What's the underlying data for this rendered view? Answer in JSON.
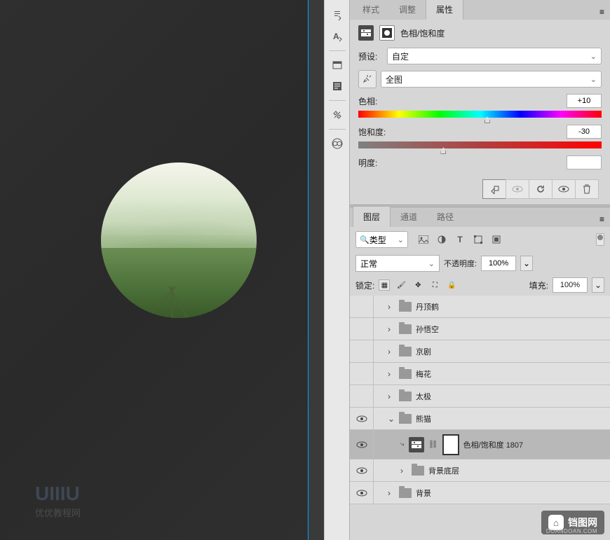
{
  "tabs": {
    "styles": "样式",
    "adjustments": "调整",
    "properties": "属性"
  },
  "properties": {
    "title": "色相/饱和度",
    "preset_label": "预设:",
    "preset_value": "自定",
    "channel_value": "全图",
    "hue_label": "色相:",
    "hue_value": "+10",
    "saturation_label": "饱和度:",
    "saturation_value": "-30",
    "lightness_label": "明度:"
  },
  "layers_tabs": {
    "layers": "图层",
    "channels": "通道",
    "paths": "路径"
  },
  "layers_panel": {
    "filter_kind": "类型",
    "blend_mode": "正常",
    "opacity_label": "不透明度:",
    "opacity_value": "100%",
    "lock_label": "锁定:",
    "fill_label": "填充:",
    "fill_value": "100%"
  },
  "layers": [
    {
      "name": "丹顶鹤",
      "type": "group",
      "expanded": false,
      "indent": 1,
      "visible": false
    },
    {
      "name": "孙悟空",
      "type": "group",
      "expanded": false,
      "indent": 1,
      "visible": false
    },
    {
      "name": "京剧",
      "type": "group",
      "expanded": false,
      "indent": 1,
      "visible": false
    },
    {
      "name": "梅花",
      "type": "group",
      "expanded": false,
      "indent": 1,
      "visible": false
    },
    {
      "name": "太极",
      "type": "group",
      "expanded": false,
      "indent": 1,
      "visible": false
    },
    {
      "name": "熊猫",
      "type": "group",
      "expanded": true,
      "indent": 1,
      "visible": true
    },
    {
      "name": "色相/饱和度 1807",
      "type": "adjustment",
      "indent": 2,
      "visible": true,
      "selected": true
    },
    {
      "name": "背景底层",
      "type": "group",
      "expanded": false,
      "indent": 2,
      "visible": true
    },
    {
      "name": "背景",
      "type": "group",
      "expanded": false,
      "indent": 1,
      "visible": true
    }
  ],
  "watermark": {
    "main": "UIIIU",
    "sub": "优优教程网"
  },
  "corner_badge": {
    "text": "铛图网",
    "sub": "DOANDOAN.COM"
  }
}
